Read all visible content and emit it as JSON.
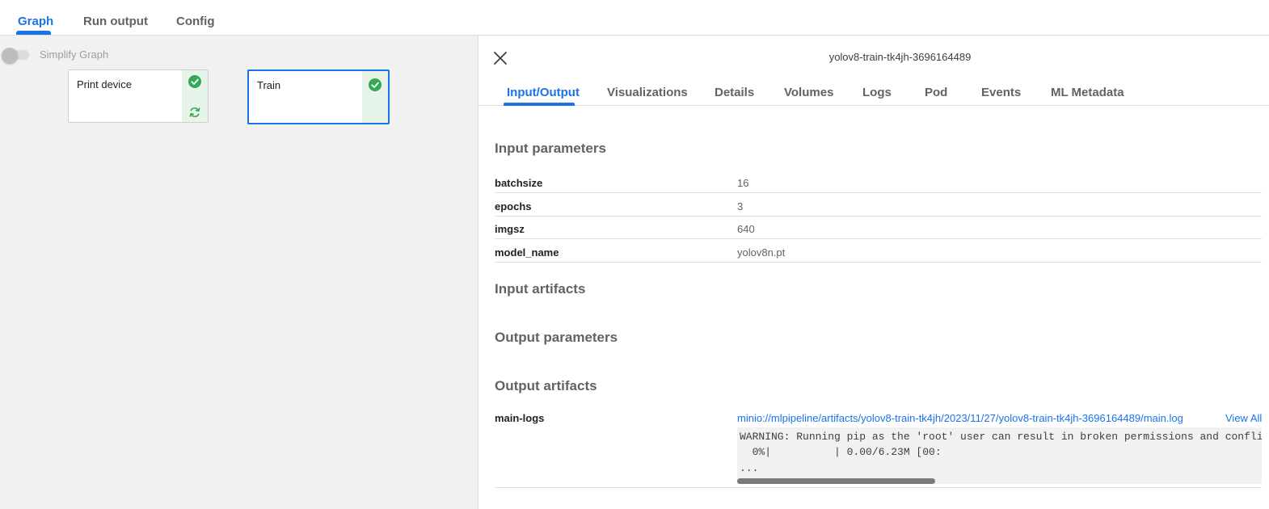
{
  "top_tabs": [
    {
      "label": "Graph",
      "active": true
    },
    {
      "label": "Run output",
      "active": false
    },
    {
      "label": "Config",
      "active": false
    }
  ],
  "graph": {
    "simplify_label": "Simplify Graph",
    "simplify_on": false,
    "nodes": [
      {
        "label": "Print device",
        "status_icons": [
          "check-circle-icon",
          "refresh-icon"
        ],
        "selected": false
      },
      {
        "label": "Train",
        "status_icons": [
          "check-circle-icon"
        ],
        "selected": true
      }
    ]
  },
  "details": {
    "title": "yolov8-train-tk4jh-3696164489",
    "tabs": [
      {
        "label": "Input/Output",
        "active": true
      },
      {
        "label": "Visualizations",
        "active": false
      },
      {
        "label": "Details",
        "active": false
      },
      {
        "label": "Volumes",
        "active": false
      },
      {
        "label": "Logs",
        "active": false
      },
      {
        "label": "Pod",
        "active": false
      },
      {
        "label": "Events",
        "active": false
      },
      {
        "label": "ML Metadata",
        "active": false
      }
    ],
    "input_parameters_title": "Input parameters",
    "input_parameters": [
      {
        "key": "batchsize",
        "value": "16"
      },
      {
        "key": "epochs",
        "value": "3"
      },
      {
        "key": "imgsz",
        "value": "640"
      },
      {
        "key": "model_name",
        "value": "yolov8n.pt"
      }
    ],
    "input_artifacts_title": "Input artifacts",
    "output_parameters_title": "Output parameters",
    "output_artifacts_title": "Output artifacts",
    "output_artifacts": [
      {
        "key": "main-logs",
        "link": "minio://mlpipeline/artifacts/yolov8-train-tk4jh/2023/11/27/yolov8-train-tk4jh-3696164489/main.log",
        "view_all": "View All",
        "preview_lines": [
          "WARNING: Running pip as the 'root' user can result in broken permissions and confli",
          "  0%|          | 0.00/6.23M [00:",
          "..."
        ]
      }
    ]
  },
  "colors": {
    "accent": "#1a73e8",
    "success": "#34a853",
    "status_bg": "#e6f4ea",
    "graph_bg": "#f1f1f1"
  }
}
